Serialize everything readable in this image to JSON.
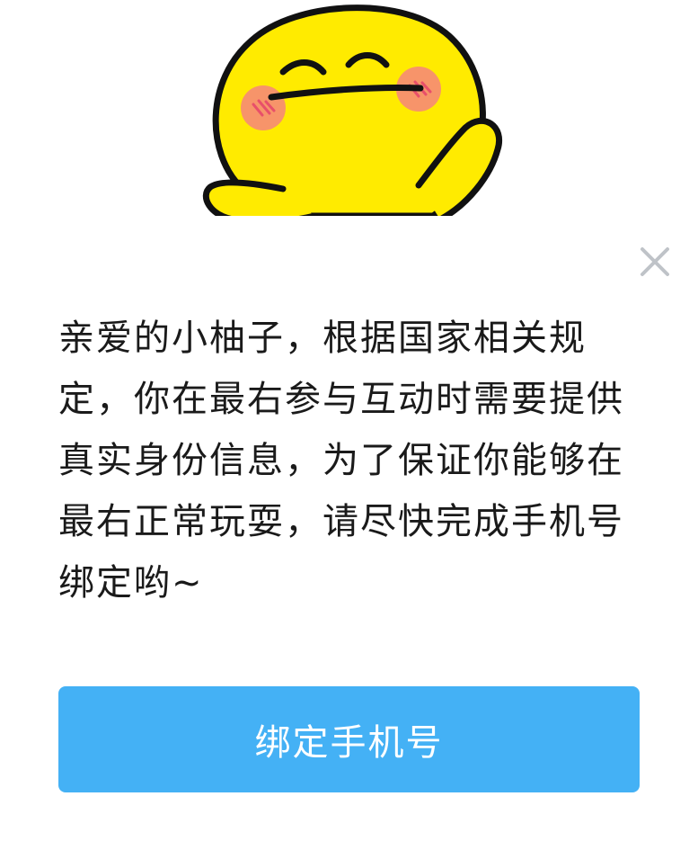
{
  "dialog": {
    "message": "亲爱的小柚子，根据国家相关规定，你在最右参与互动时需要提供真实身份信息，为了保证你能够在最右正常玩耍，请尽快完成手机号绑定哟~",
    "bind_button_label": "绑定手机号",
    "close_icon": "close-icon",
    "mascot_icon": "shy-smiley-mascot-icon"
  },
  "colors": {
    "button": "#44b1f5",
    "button_text": "#ffffff",
    "text": "#1a1a1a",
    "close_icon": "#bfc3c8",
    "mascot_face": "#ffeb00",
    "mascot_cheek": "#f7946a"
  }
}
